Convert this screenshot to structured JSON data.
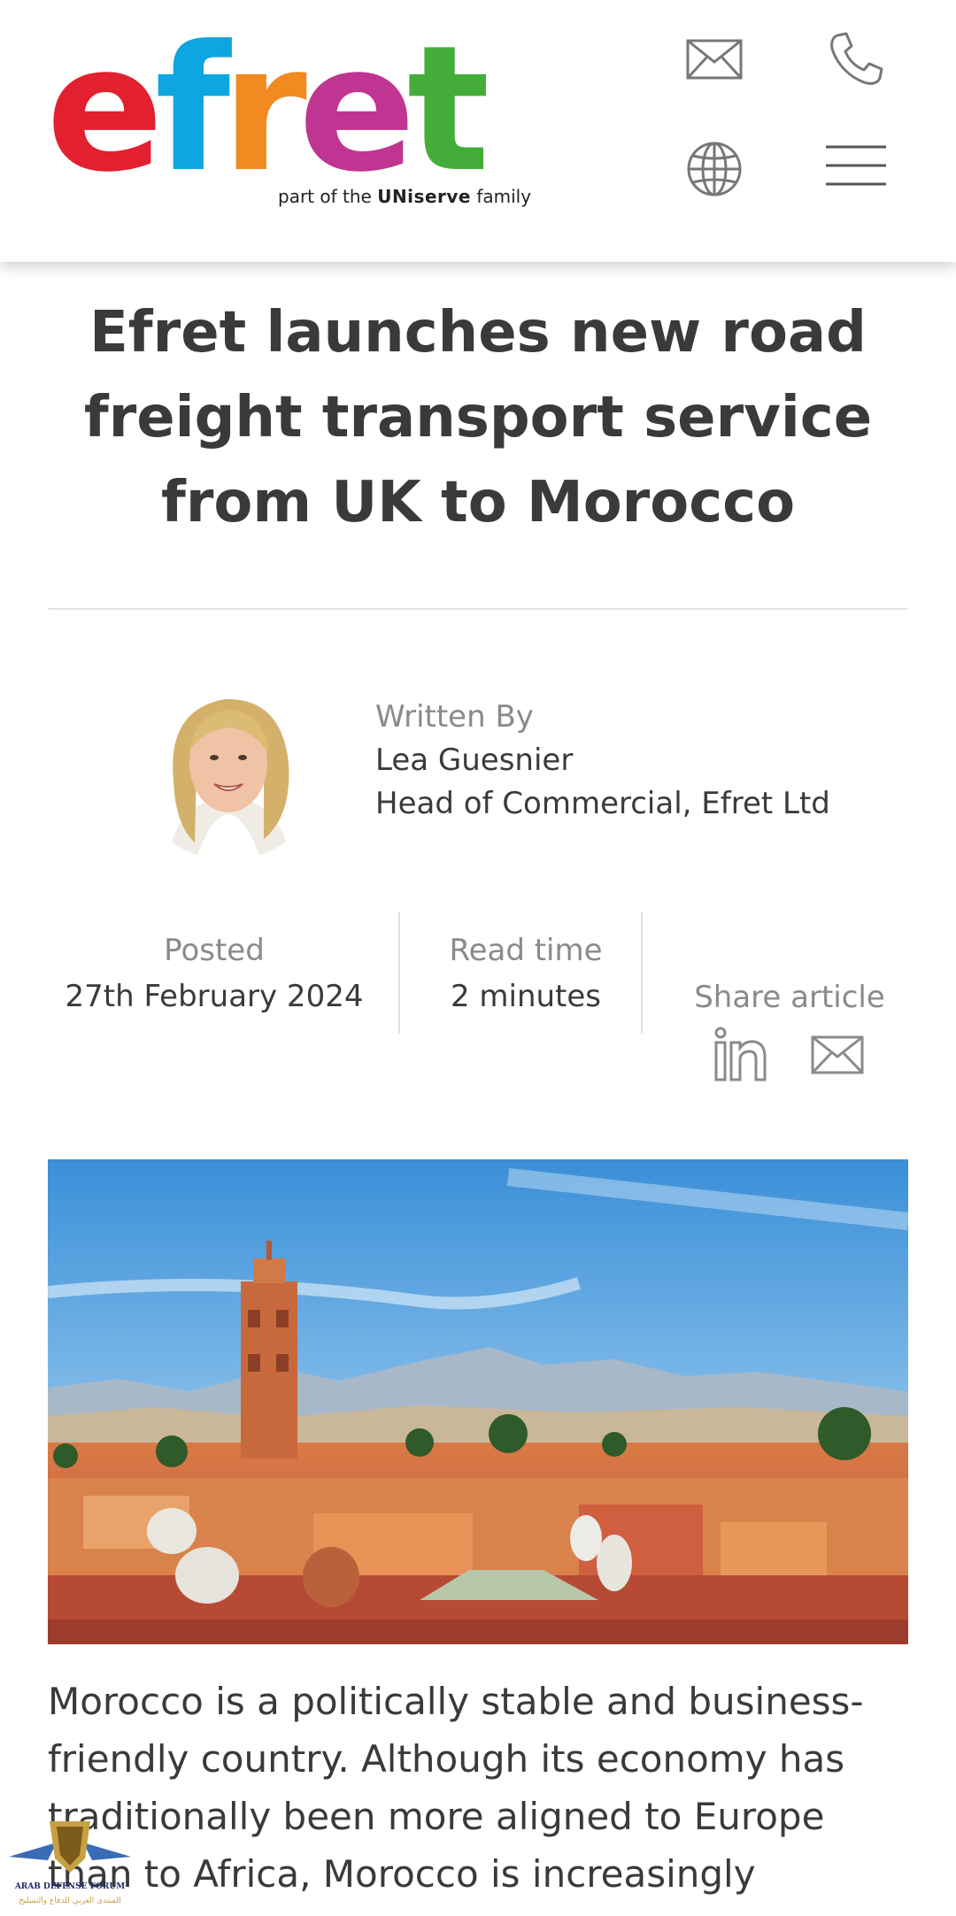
{
  "header": {
    "logo": {
      "letters": [
        {
          "char": "e",
          "color": "#e2202f"
        },
        {
          "char": "f",
          "color": "#0ea6e0"
        },
        {
          "char": "r",
          "color": "#f18a21"
        },
        {
          "char": "e",
          "color": "#c03592"
        },
        {
          "char": "t",
          "color": "#44ad3a"
        }
      ],
      "tagline_prefix": "part of the",
      "tagline_brand": "UNiserve",
      "tagline_suffix": "family"
    },
    "icons": [
      "mail-icon",
      "phone-icon",
      "globe-icon",
      "menu-icon"
    ]
  },
  "article": {
    "title": "Efret launches new road freight transport service from UK to Morocco",
    "author": {
      "label": "Written By",
      "name": "Lea Guesnier",
      "role": "Head of Commercial, Efret Ltd"
    },
    "meta": {
      "posted_label": "Posted",
      "posted_value": "27th February 2024",
      "read_time_label": "Read time",
      "read_time_value": "2 minutes",
      "share_label": "Share article",
      "share_icons": [
        "linkedin-icon",
        "mail-icon"
      ]
    },
    "hero_alt": "Marrakech skyline with minaret and mountains",
    "body": "Morocco is a politically stable and business-friendly country. Although its economy has traditionally been more aligned to Europe than to Africa, Morocco is increasingly"
  },
  "watermark": {
    "line1": "ARAB DEFENSE FORUM",
    "line2": "المنتدى العربي للدفاع والتسليح"
  },
  "colors": {
    "text": "#3a3a3a",
    "muted": "#8a8a8a",
    "icon_gray": "#777777"
  }
}
